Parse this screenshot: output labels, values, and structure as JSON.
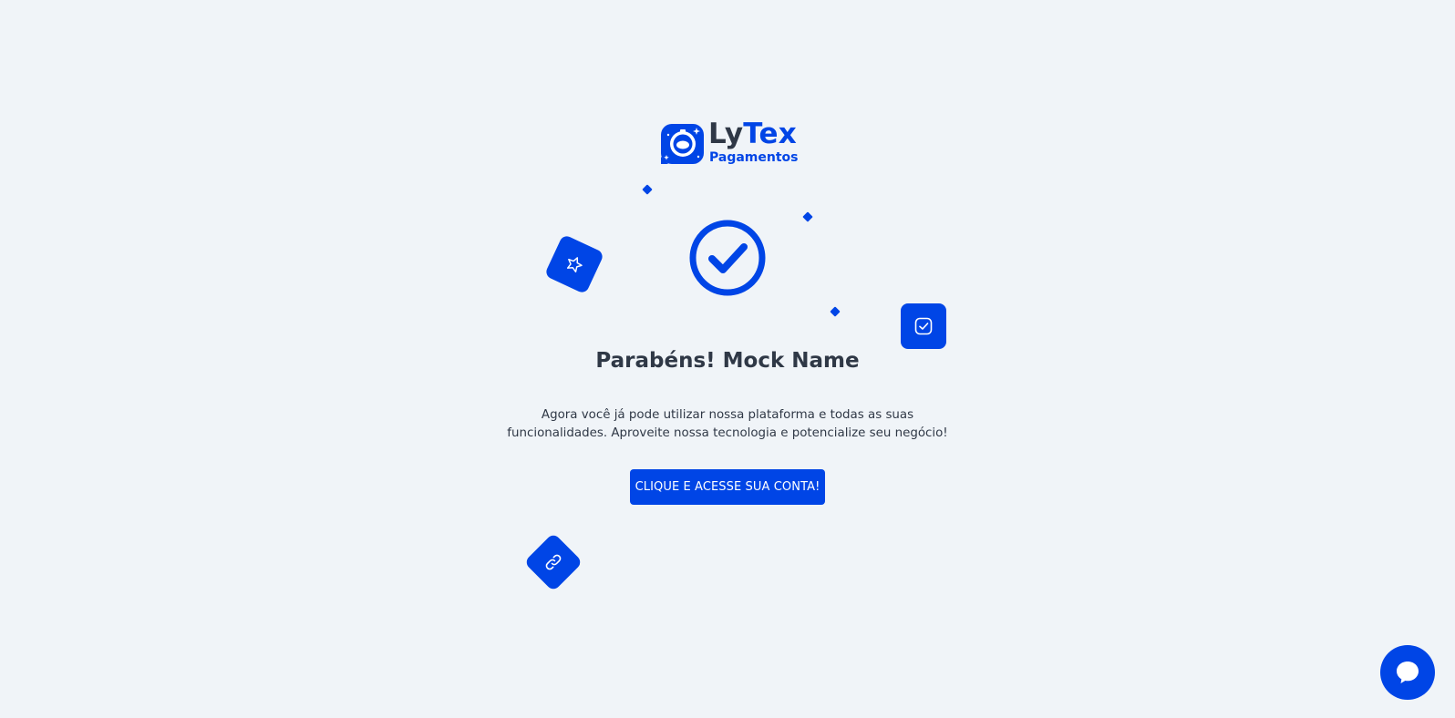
{
  "brand": {
    "name_part1": "Ly",
    "name_part2": "Tex",
    "subtitle": "Pagamentos",
    "logo_icon": "astronaut-icon",
    "primary_color": "#0045e6",
    "text_color": "#2f3846",
    "background_color": "#f0f4f8"
  },
  "success": {
    "icon": "check-circle-icon",
    "title": "Parabéns! Mock Name",
    "description_line1": "Agora você já pode utilizar nossa plataforma e todas as suas",
    "description_line2": "funcionalidades. Aproveite nossa tecnologia e potencialize seu negócio!"
  },
  "cta": {
    "label": "CLIQUE E ACESSE SUA CONTA!"
  },
  "decor": {
    "icons": [
      "star-icon",
      "checkbox-icon",
      "link-icon"
    ]
  },
  "chat": {
    "icon": "chat-bubble-icon"
  }
}
